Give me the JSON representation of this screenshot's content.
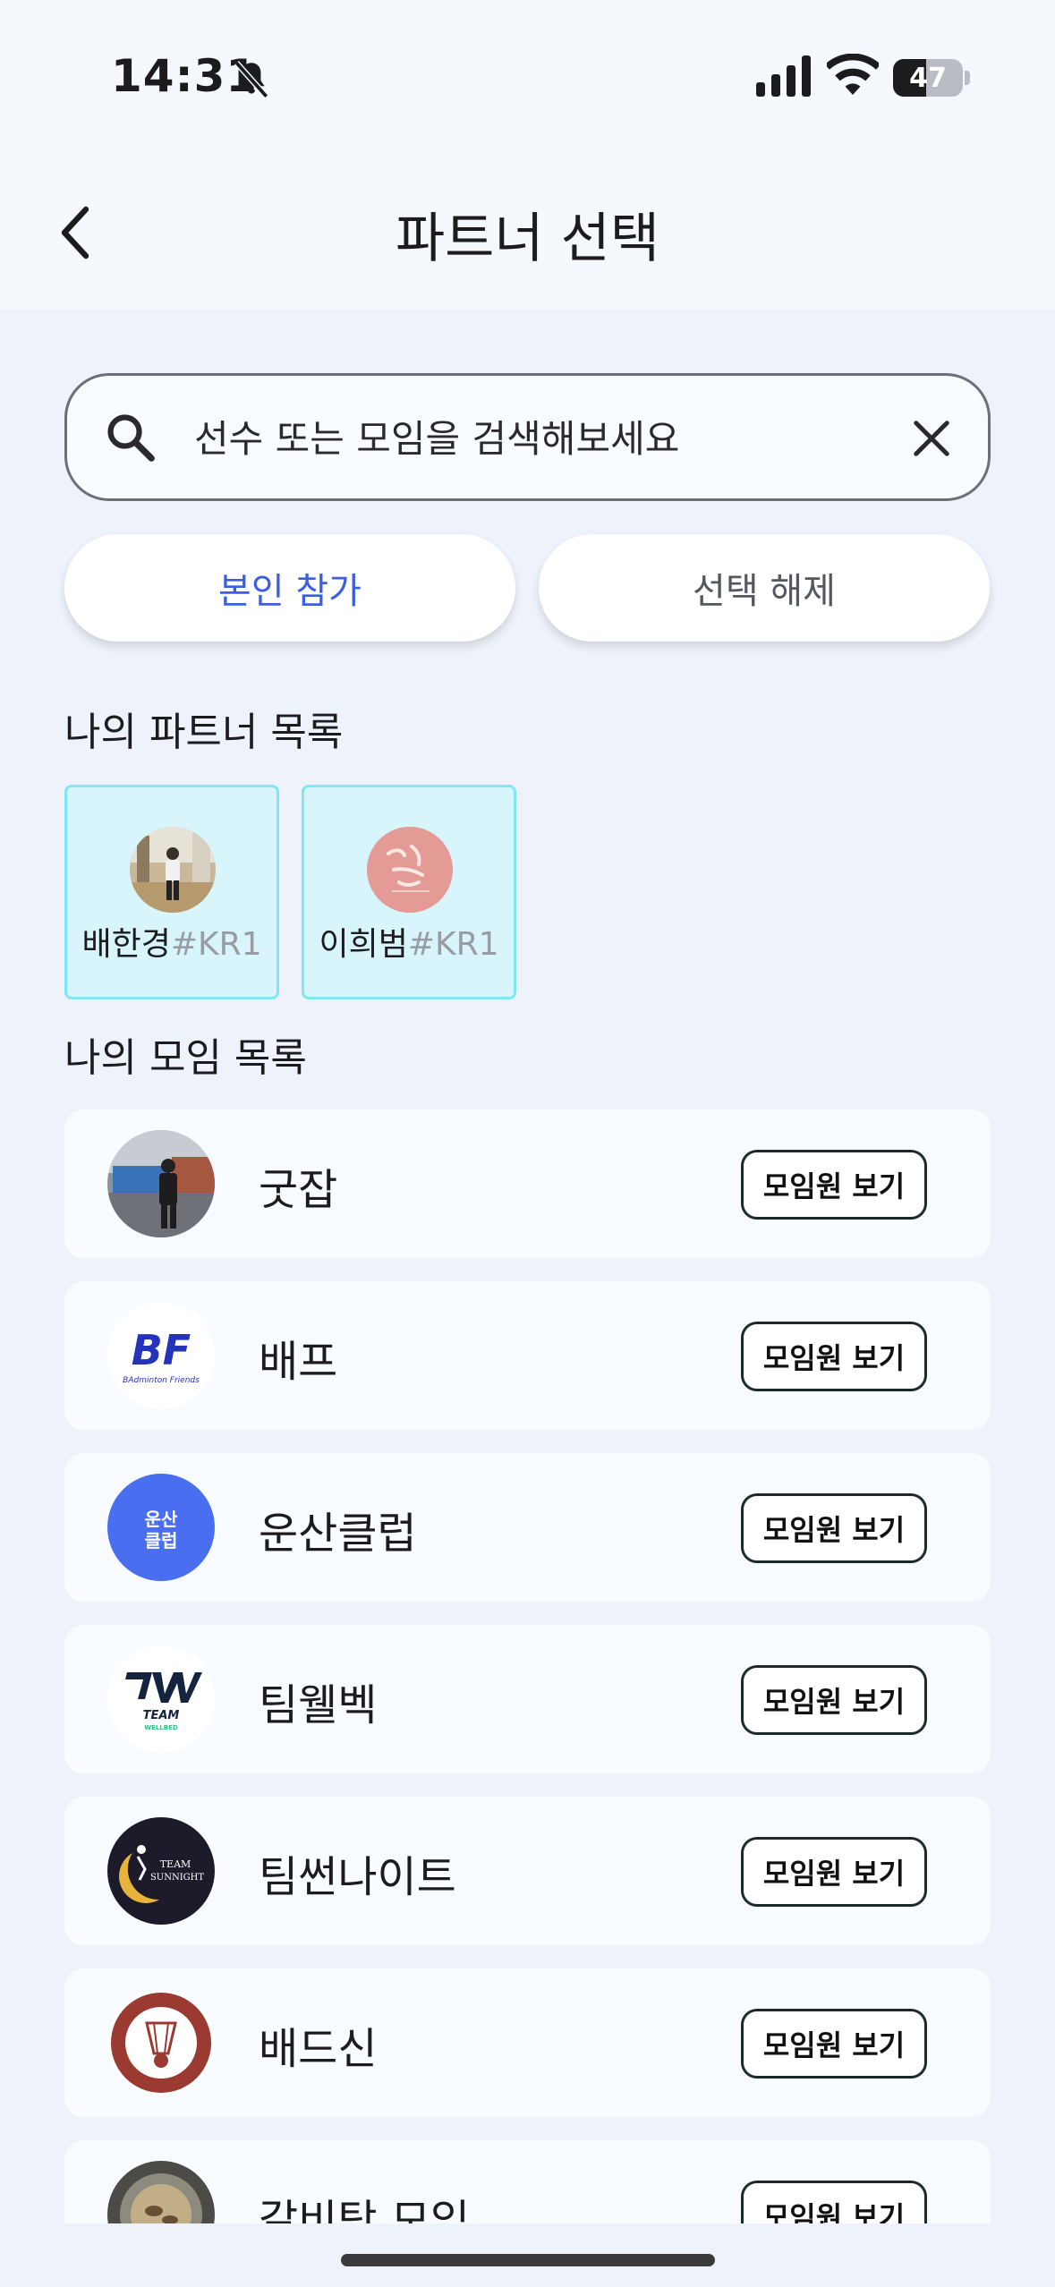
{
  "status_bar": {
    "time": "14:31",
    "battery": "47",
    "battery_level": 0.47
  },
  "header": {
    "title": "파트너 선택"
  },
  "search": {
    "placeholder": "선수 또는 모임을 검색해보세요"
  },
  "actions": {
    "self_join": "본인 참가",
    "deselect": "선택 해제"
  },
  "partners": {
    "title": "나의 파트너 목록",
    "items": [
      {
        "name": "배한경",
        "tag": "#KR1"
      },
      {
        "name": "이희범",
        "tag": "#KR1"
      }
    ]
  },
  "groups": {
    "title": "나의 모임 목록",
    "button_label": "모임원 보기",
    "items": [
      {
        "name": "굿잡"
      },
      {
        "name": "배프",
        "logo_text": "BF",
        "logo_sub": "BAdminton Friends"
      },
      {
        "name": "운산클럽",
        "logo_text": "운산\n클럽"
      },
      {
        "name": "팀웰벡",
        "logo_text": "TEAM",
        "logo_sub": "WELLBED"
      },
      {
        "name": "팀썬나이트",
        "logo_text": "TEAM SUNNIGHT"
      },
      {
        "name": "배드신"
      },
      {
        "name": "갈비탕 모임"
      }
    ]
  },
  "colors": {
    "accent_blue": "#3b5fe0",
    "partner_card_bg": "#d7f5fb",
    "partner_card_border": "#7fe6f3"
  }
}
